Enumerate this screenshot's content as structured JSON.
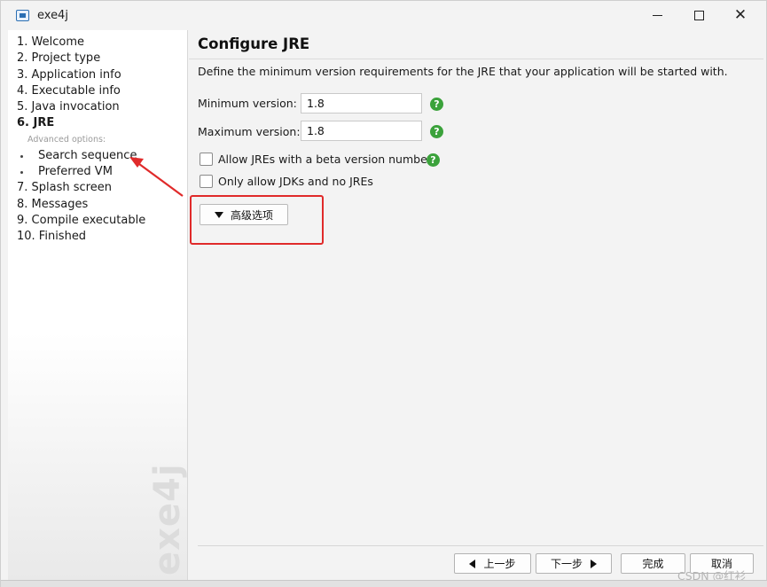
{
  "window": {
    "title": "exe4j",
    "controls": {
      "minimize": "minimize",
      "maximize": "maximize",
      "close": "✕"
    }
  },
  "nav": {
    "items": [
      {
        "label": "1. Welcome"
      },
      {
        "label": "2. Project type"
      },
      {
        "label": "3. Application info"
      },
      {
        "label": "4. Executable info"
      },
      {
        "label": "5. Java invocation"
      },
      {
        "label": "6. JRE"
      }
    ],
    "advanced_label": "Advanced options:",
    "sub_items": [
      {
        "label": "Search sequence"
      },
      {
        "label": "Preferred VM"
      }
    ],
    "items_after": [
      {
        "label": "7. Splash screen"
      },
      {
        "label": "8. Messages"
      },
      {
        "label": "9. Compile executable"
      },
      {
        "label": "10. Finished"
      }
    ],
    "active_index": 5,
    "watermark": "exe4j"
  },
  "content": {
    "title": "Configure JRE",
    "description": "Define the minimum version requirements for the JRE that your application will be started with.",
    "min_version": {
      "label": "Minimum version:",
      "value": "1.8"
    },
    "max_version": {
      "label": "Maximum version:",
      "value": "1.8"
    },
    "help_glyph": "?",
    "checkbox_beta": {
      "label": "Allow JREs with a beta version number",
      "checked": false
    },
    "checkbox_jdk": {
      "label": "Only allow JDKs and no JREs",
      "checked": false
    },
    "advanced_button": "高级选项"
  },
  "footer": {
    "back": "上一步",
    "next": "下一步",
    "finish": "完成",
    "cancel": "取消"
  },
  "watermark_text": "CSDN @红衫",
  "colors": {
    "highlight": "#e02a2a",
    "help_green": "#3ba23b"
  }
}
